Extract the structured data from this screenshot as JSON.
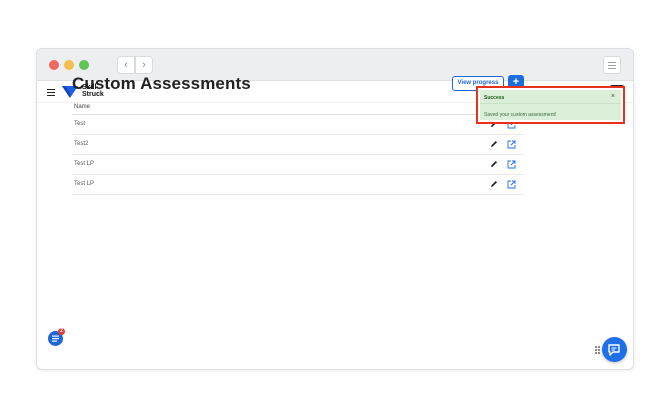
{
  "window": {
    "nav": {
      "back_glyph": "‹",
      "forward_glyph": "›"
    },
    "icons": [
      "close-dot",
      "minimize-dot",
      "maximize-dot",
      "window-menu-icon"
    ]
  },
  "header": {
    "brand_line1": "Skill",
    "brand_line2": "Struck",
    "brand_color": "#1c5ee8"
  },
  "main": {
    "title": "Custom Assessments",
    "view_progress_label": "View progress",
    "add_label": "+",
    "table": {
      "column_name": "Name",
      "rows": [
        {
          "name": "Test"
        },
        {
          "name": "Test2"
        },
        {
          "name": "Test LP"
        },
        {
          "name": "Test LP"
        }
      ]
    }
  },
  "toast": {
    "title": "Success",
    "close_label": "×",
    "message": "Saved your custom assessment!",
    "highlight_color": "#e8311a",
    "bg_color": "#dbeed8"
  },
  "widget": {
    "badge_count": "2"
  },
  "colors": {
    "accent": "#1c6ee0",
    "text": "#222222"
  }
}
